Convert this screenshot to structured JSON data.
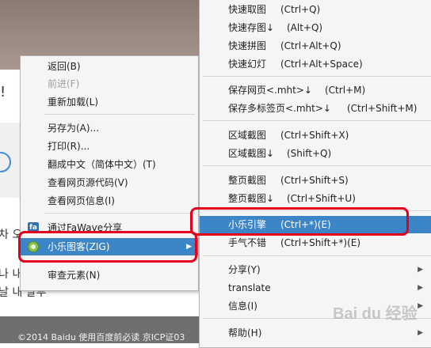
{
  "background": {
    "exclamation": "!",
    "korean_line1": "차 오늘",
    "korean_line2": "나 내",
    "korean_line3": "날 내 말투",
    "footer": "©2014  Baidu  使用百度前必读  京ICP证03"
  },
  "left_menu": {
    "items": [
      {
        "label": "返回(B)",
        "disabled": false
      },
      {
        "label": "前进(F)",
        "disabled": true
      },
      {
        "label": "重新加载(L)",
        "disabled": false
      },
      {
        "label": "另存为(A)...",
        "disabled": false
      },
      {
        "label": "打印(R)...",
        "disabled": false
      },
      {
        "label": "翻成中文（简体中文）(T)",
        "disabled": false
      },
      {
        "label": "查看网页源代码(V)",
        "disabled": false
      },
      {
        "label": "查看网页信息(I)",
        "disabled": false
      },
      {
        "label": "通过FaWave分享",
        "disabled": false,
        "icon": "fawave-icon",
        "icon_text": "fa"
      },
      {
        "label": "小乐图客(ZIG)",
        "disabled": false,
        "icon": "xiaole-icon",
        "highlighted": true,
        "submenu": true
      },
      {
        "label": "审查元素(N)",
        "disabled": false
      }
    ]
  },
  "right_menu": {
    "items": [
      {
        "label": "快速取图",
        "shortcut": "(Ctrl+Q)"
      },
      {
        "label": "快速存图↓",
        "shortcut": "(Alt+Q)"
      },
      {
        "label": "快速拼图",
        "shortcut": "(Ctrl+Alt+Q)"
      },
      {
        "label": "快速幻灯",
        "shortcut": "(Ctrl+Alt+Space)"
      },
      {
        "label": "保存网页<.mht>↓",
        "shortcut": "(Ctrl+M)"
      },
      {
        "label": "保存多标签页<.mht>↓",
        "shortcut": "(Ctrl+Shift+M)"
      },
      {
        "label": "区域截图",
        "shortcut": "(Ctrl+Shift+X)"
      },
      {
        "label": "区域截图↓",
        "shortcut": "(Shift+Q)"
      },
      {
        "label": "整页截图",
        "shortcut": "(Ctrl+Shift+S)"
      },
      {
        "label": "整页截图↓",
        "shortcut": "(Ctrl+Shift+U)"
      },
      {
        "label": "小乐引擎",
        "shortcut": "(Ctrl+*)(E)",
        "highlighted": true
      },
      {
        "label": "手气不错",
        "shortcut": "(Ctrl+Shift+*)(E)"
      },
      {
        "label": "分享(Y)",
        "shortcut": "",
        "submenu": true
      },
      {
        "label": "translate",
        "shortcut": "",
        "submenu": true
      },
      {
        "label": "信息(I)",
        "shortcut": "",
        "submenu": true
      },
      {
        "label": "帮助(H)",
        "shortcut": "",
        "submenu": true
      }
    ]
  },
  "watermark": "Bai du 经验",
  "colors": {
    "highlight": "#3c86c8",
    "annotation_red": "#e3001b",
    "menu_bg": "#f5f5f5"
  }
}
